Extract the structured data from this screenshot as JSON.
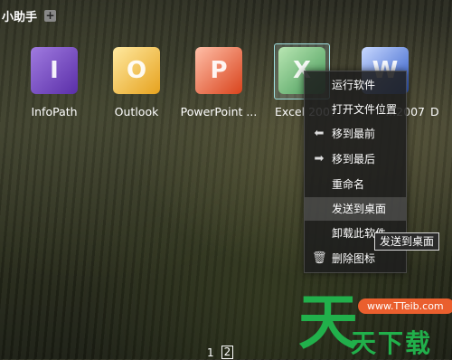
{
  "header": {
    "title": "小助手",
    "add_icon": "plus-icon"
  },
  "apps": [
    {
      "label": "InfoPath",
      "icon": "infopath-icon",
      "color": "#6a3bbd"
    },
    {
      "label": "Outlook",
      "icon": "outlook-icon",
      "color": "#f2b53a"
    },
    {
      "label": "PowerPoint ...",
      "icon": "powerpoint-icon",
      "color": "#d9431c"
    },
    {
      "label": "Excel 2007",
      "icon": "excel-icon",
      "color": "#2d8a3a",
      "selected": true
    },
    {
      "label": "...2007",
      "icon": "word-icon",
      "color": "#2f5bc8"
    },
    {
      "label": "D",
      "icon": "app-icon"
    }
  ],
  "context_menu": {
    "items": [
      {
        "label": "运行软件",
        "icon": ""
      },
      {
        "label": "打开文件位置",
        "icon": ""
      },
      {
        "label": "移到最前",
        "icon": "arrow-left-icon"
      },
      {
        "label": "移到最后",
        "icon": "arrow-right-icon"
      },
      {
        "label": "重命名",
        "icon": ""
      },
      {
        "label": "发送到桌面",
        "icon": "",
        "hover": true
      },
      {
        "label": "卸载此软件",
        "icon": ""
      },
      {
        "label": "删除图标",
        "icon": "trash-icon"
      }
    ]
  },
  "tooltip": {
    "text": "发送到桌面"
  },
  "pager": {
    "pages": [
      "1",
      "2"
    ],
    "active": "2"
  },
  "watermark": {
    "big": "天",
    "url": "www.TTeib.com",
    "text": "天下载"
  }
}
